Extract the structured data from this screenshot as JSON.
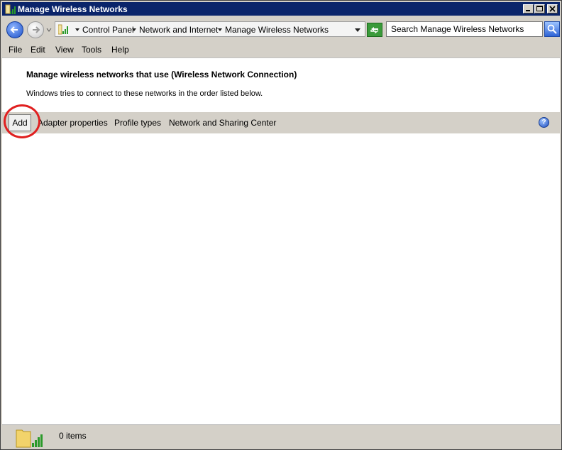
{
  "window": {
    "title": "Manage Wireless Networks"
  },
  "address": {
    "crumbs": [
      "Control Panel",
      "Network and Internet",
      "Manage Wireless Networks"
    ],
    "search_placeholder": "Search Manage Wireless Networks"
  },
  "menu": {
    "file": "File",
    "edit": "Edit",
    "view": "View",
    "tools": "Tools",
    "help": "Help"
  },
  "content": {
    "heading": "Manage wireless networks that use (Wireless Network Connection)",
    "description": "Windows tries to connect to these networks in the order listed below."
  },
  "commands": {
    "add": "Add",
    "adapter_properties": "Adapter properties",
    "profile_types": "Profile types",
    "network_sharing_center": "Network and Sharing Center",
    "help_glyph": "?"
  },
  "status": {
    "items": "0 items"
  },
  "colors": {
    "titlebar": "#0a246a",
    "annotation": "#e02020"
  }
}
